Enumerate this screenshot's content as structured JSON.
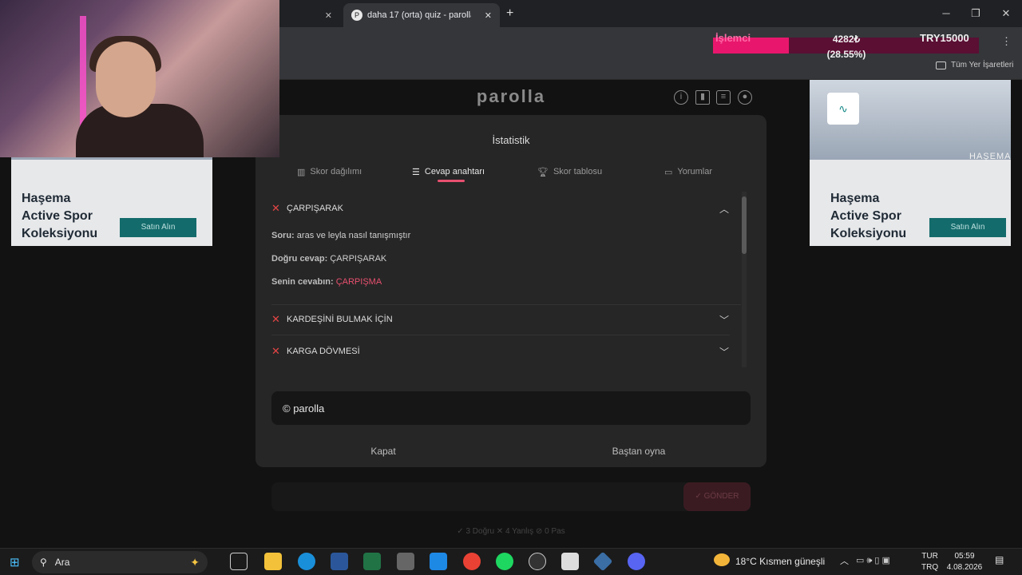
{
  "browser": {
    "tab_inactive_close": "✕",
    "tab_active_title": "daha 17 (orta) quiz - parolla",
    "new_tab": "+",
    "bookmark_folder": "Tüm Yer İşaretleri"
  },
  "overlay": {
    "label": "İşlemci",
    "value": "4282₺",
    "percent_text": "(28.55%)",
    "goal": "TRY15000",
    "progress_fraction": 0.2855
  },
  "site": {
    "logo": "parolla"
  },
  "ads": {
    "left": {
      "title_line1": "Haşema",
      "title_line2": "Active Spor",
      "title_line3": "Koleksiyonu",
      "button": "Satın Alın"
    },
    "right": {
      "title_line1": "Haşema",
      "title_line2": "Active Spor",
      "title_line3": "Koleksiyonu",
      "button": "Satın Alın",
      "brand": "HAŞEMA"
    }
  },
  "modal": {
    "title": "İstatistik",
    "tabs": [
      {
        "label": "Skor dağılımı",
        "icon": "bar-chart-icon"
      },
      {
        "label": "Cevap anahtarı",
        "icon": "list-check-icon"
      },
      {
        "label": "Skor tablosu",
        "icon": "trophy-icon"
      },
      {
        "label": "Yorumlar",
        "icon": "comment-icon"
      }
    ],
    "answers": [
      {
        "word": "ÇARPIŞARAK",
        "expanded": true
      },
      {
        "word": "KARDEŞİNİ BULMAK İÇİN",
        "expanded": false
      },
      {
        "word": "KARGA DÖVMESİ",
        "expanded": false
      }
    ],
    "detail": {
      "question_label": "Soru:",
      "question": "aras ve leyla nasıl tanışmıştır",
      "correct_label": "Doğru cevap:",
      "correct": "ÇARPIŞARAK",
      "yours_label": "Senin cevabın:",
      "yours": "ÇARPIŞMA"
    },
    "credit": "© parolla",
    "close": "Kapat",
    "replay": "Baştan oyna"
  },
  "behind": {
    "send": "✓ GÖNDER",
    "stats": "✓ 3 Doğru   ✕ 4 Yanlış   ⊘ 0 Pas"
  },
  "taskbar": {
    "search": "Ara",
    "weather": "18°C  Kısmen güneşli",
    "lang1": "TUR",
    "lang2": "TRQ",
    "time": "05:59",
    "date": "4.08.2026"
  },
  "colors": {
    "accent": "#e8506f",
    "wrong": "#e64545",
    "overlay_fill": "#e8176d"
  }
}
